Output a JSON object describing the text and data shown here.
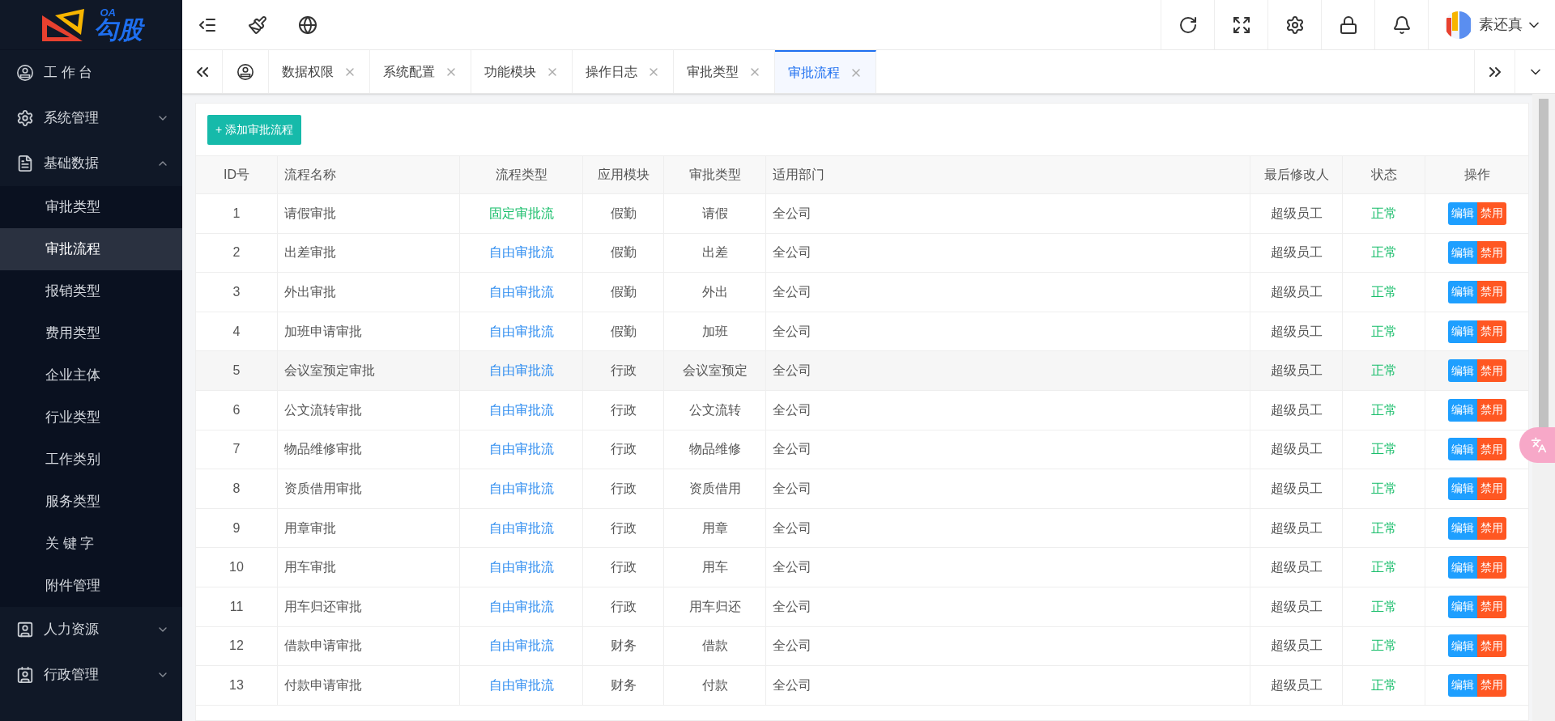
{
  "logo": {
    "small": "OA",
    "name": "勾股"
  },
  "sidebar": {
    "items": [
      {
        "label": "工 作 台"
      },
      {
        "label": "系统管理",
        "expanded": false
      },
      {
        "label": "基础数据",
        "expanded": true,
        "children": [
          {
            "label": "审批类型",
            "selected": false
          },
          {
            "label": "审批流程",
            "selected": true
          },
          {
            "label": "报销类型",
            "selected": false
          },
          {
            "label": "费用类型",
            "selected": false
          },
          {
            "label": "企业主体",
            "selected": false
          },
          {
            "label": "行业类型",
            "selected": false
          },
          {
            "label": "工作类别",
            "selected": false
          },
          {
            "label": "服务类型",
            "selected": false
          },
          {
            "label": "关 键 字",
            "selected": false
          },
          {
            "label": "附件管理",
            "selected": false
          }
        ]
      },
      {
        "label": "人力资源",
        "expanded": false
      },
      {
        "label": "行政管理",
        "expanded": false
      }
    ]
  },
  "header": {
    "user": "素还真"
  },
  "tabs": [
    {
      "label": "数据权限",
      "selected": false
    },
    {
      "label": "系统配置",
      "selected": false
    },
    {
      "label": "功能模块",
      "selected": false
    },
    {
      "label": "操作日志",
      "selected": false
    },
    {
      "label": "审批类型",
      "selected": false
    },
    {
      "label": "审批流程",
      "selected": true
    }
  ],
  "add_button": "+ 添加审批流程",
  "table": {
    "columns": [
      "ID号",
      "流程名称",
      "流程类型",
      "应用模块",
      "审批类型",
      "适用部门",
      "最后修改人",
      "状态",
      "操作"
    ],
    "rows": [
      {
        "id": "1",
        "name": "请假审批",
        "flow_type": {
          "text": "固定审批流",
          "color": "#19be6b"
        },
        "module": "假勤",
        "type": "请假",
        "dept": "全公司",
        "modifier": "超级员工",
        "status": "正常",
        "actions": [
          "编辑",
          "禁用"
        ]
      },
      {
        "id": "2",
        "name": "出差审批",
        "flow_type": {
          "text": "自由审批流",
          "color": "#2d8cf0"
        },
        "module": "假勤",
        "type": "出差",
        "dept": "全公司",
        "modifier": "超级员工",
        "status": "正常",
        "actions": [
          "编辑",
          "禁用"
        ]
      },
      {
        "id": "3",
        "name": "外出审批",
        "flow_type": {
          "text": "自由审批流",
          "color": "#2d8cf0"
        },
        "module": "假勤",
        "type": "外出",
        "dept": "全公司",
        "modifier": "超级员工",
        "status": "正常",
        "actions": [
          "编辑",
          "禁用"
        ]
      },
      {
        "id": "4",
        "name": "加班申请审批",
        "flow_type": {
          "text": "自由审批流",
          "color": "#2d8cf0"
        },
        "module": "假勤",
        "type": "加班",
        "dept": "全公司",
        "modifier": "超级员工",
        "status": "正常",
        "actions": [
          "编辑",
          "禁用"
        ]
      },
      {
        "id": "5",
        "name": "会议室预定审批",
        "flow_type": {
          "text": "自由审批流",
          "color": "#2d8cf0"
        },
        "module": "行政",
        "type": "会议室预定",
        "dept": "全公司",
        "modifier": "超级员工",
        "status": "正常",
        "actions": [
          "编辑",
          "禁用"
        ]
      },
      {
        "id": "6",
        "name": "公文流转审批",
        "flow_type": {
          "text": "自由审批流",
          "color": "#2d8cf0"
        },
        "module": "行政",
        "type": "公文流转",
        "dept": "全公司",
        "modifier": "超级员工",
        "status": "正常",
        "actions": [
          "编辑",
          "禁用"
        ]
      },
      {
        "id": "7",
        "name": "物品维修审批",
        "flow_type": {
          "text": "自由审批流",
          "color": "#2d8cf0"
        },
        "module": "行政",
        "type": "物品维修",
        "dept": "全公司",
        "modifier": "超级员工",
        "status": "正常",
        "actions": [
          "编辑",
          "禁用"
        ]
      },
      {
        "id": "8",
        "name": "资质借用审批",
        "flow_type": {
          "text": "自由审批流",
          "color": "#2d8cf0"
        },
        "module": "行政",
        "type": "资质借用",
        "dept": "全公司",
        "modifier": "超级员工",
        "status": "正常",
        "actions": [
          "编辑",
          "禁用"
        ]
      },
      {
        "id": "9",
        "name": "用章审批",
        "flow_type": {
          "text": "自由审批流",
          "color": "#2d8cf0"
        },
        "module": "行政",
        "type": "用章",
        "dept": "全公司",
        "modifier": "超级员工",
        "status": "正常",
        "actions": [
          "编辑",
          "禁用"
        ]
      },
      {
        "id": "10",
        "name": "用车审批",
        "flow_type": {
          "text": "自由审批流",
          "color": "#2d8cf0"
        },
        "module": "行政",
        "type": "用车",
        "dept": "全公司",
        "modifier": "超级员工",
        "status": "正常",
        "actions": [
          "编辑",
          "禁用"
        ]
      },
      {
        "id": "11",
        "name": "用车归还审批",
        "flow_type": {
          "text": "自由审批流",
          "color": "#2d8cf0"
        },
        "module": "行政",
        "type": "用车归还",
        "dept": "全公司",
        "modifier": "超级员工",
        "status": "正常",
        "actions": [
          "编辑",
          "禁用"
        ]
      },
      {
        "id": "12",
        "name": "借款申请审批",
        "flow_type": {
          "text": "自由审批流",
          "color": "#2d8cf0"
        },
        "module": "财务",
        "type": "借款",
        "dept": "全公司",
        "modifier": "超级员工",
        "status": "正常",
        "actions": [
          "编辑",
          "禁用"
        ]
      },
      {
        "id": "13",
        "name": "付款申请审批",
        "flow_type": {
          "text": "自由审批流",
          "color": "#2d8cf0"
        },
        "module": "财务",
        "type": "付款",
        "dept": "全公司",
        "modifier": "超级员工",
        "status": "正常",
        "actions": [
          "编辑",
          "禁用"
        ]
      }
    ]
  }
}
